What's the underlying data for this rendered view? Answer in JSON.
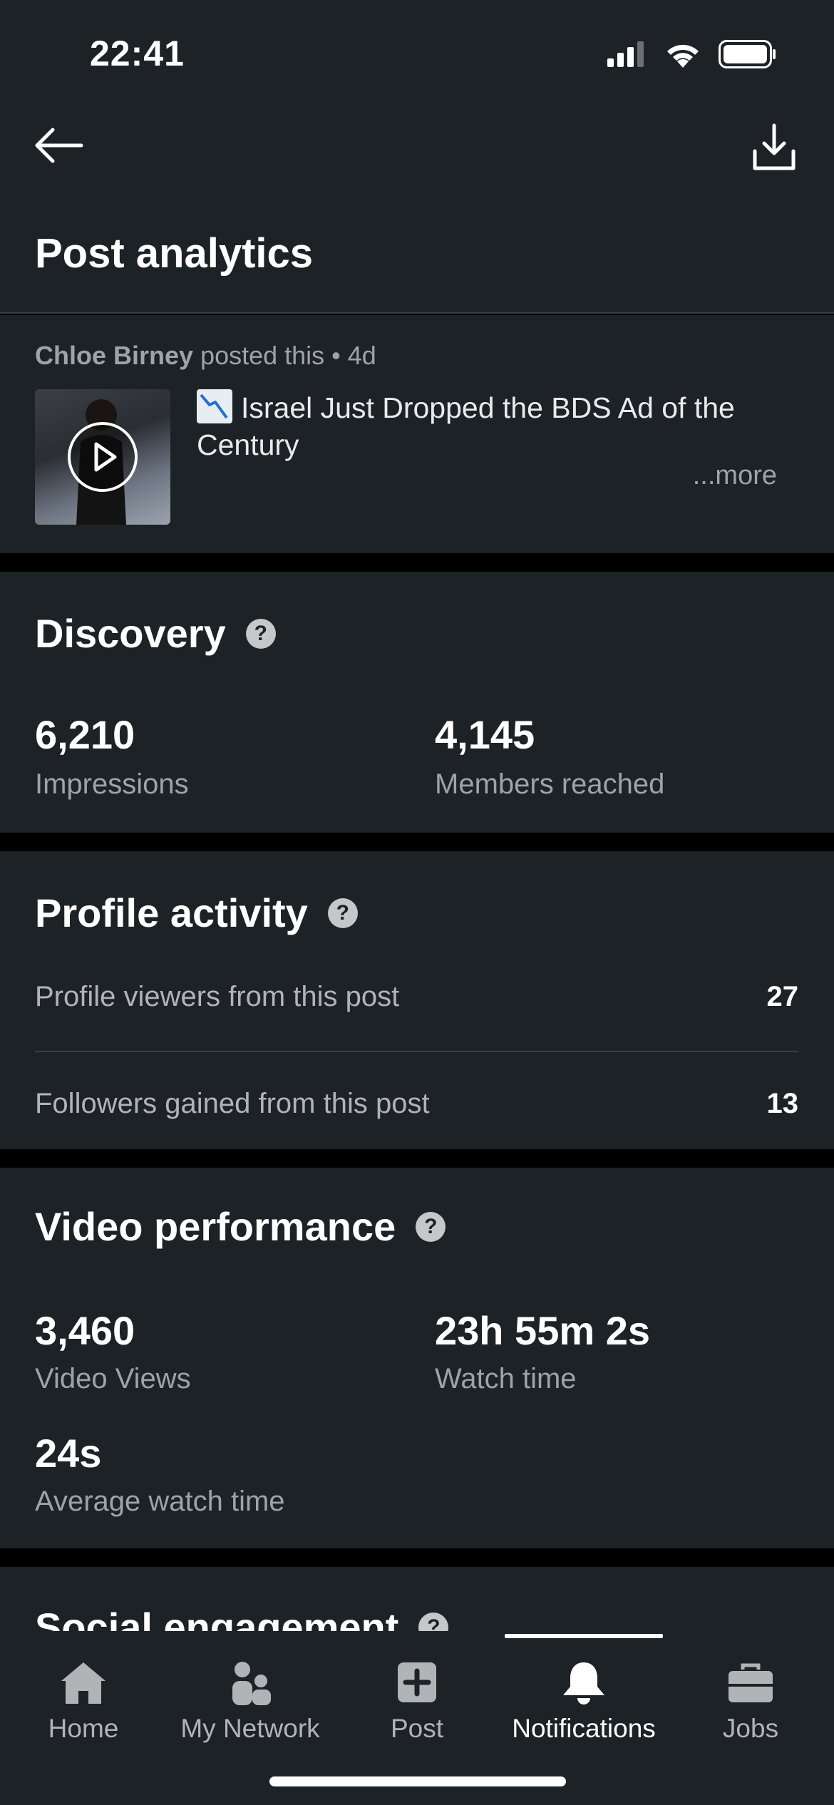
{
  "status_bar": {
    "time": "22:41"
  },
  "header": {
    "title": "Post analytics"
  },
  "post": {
    "author": "Chloe Birney",
    "meta": " posted this • 4d",
    "title": "Israel Just Dropped the BDS Ad of the Century",
    "more": "...more"
  },
  "discovery": {
    "title": "Discovery",
    "impressions_value": "6,210",
    "impressions_label": "Impressions",
    "reached_value": "4,145",
    "reached_label": "Members reached"
  },
  "profile_activity": {
    "title": "Profile activity",
    "rows": [
      {
        "label": "Profile viewers from this post",
        "value": "27"
      },
      {
        "label": "Followers gained from this post",
        "value": "13"
      }
    ]
  },
  "video_performance": {
    "title": "Video performance",
    "views_value": "3,460",
    "views_label": "Video Views",
    "watch_value": "23h 55m 2s",
    "watch_label": "Watch time",
    "avg_value": "24s",
    "avg_label": "Average watch time"
  },
  "social_engagement": {
    "title": "Social engagement"
  },
  "bottom_nav": {
    "items": [
      {
        "label": "Home",
        "icon": "home-icon"
      },
      {
        "label": "My Network",
        "icon": "network-icon"
      },
      {
        "label": "Post",
        "icon": "post-icon"
      },
      {
        "label": "Notifications",
        "icon": "bell-icon",
        "active": true
      },
      {
        "label": "Jobs",
        "icon": "briefcase-icon"
      }
    ]
  },
  "colors": {
    "background": "#1d2226",
    "muted_text": "#9ea3a7",
    "separator": "#000000"
  }
}
